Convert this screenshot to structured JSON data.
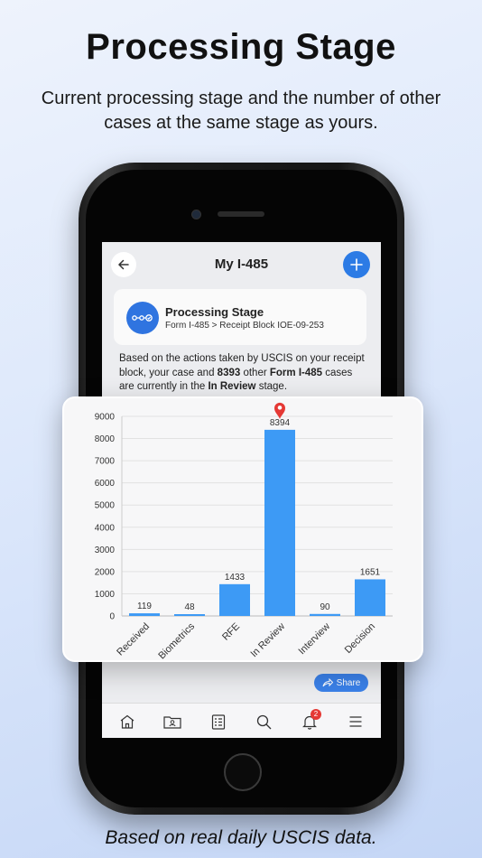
{
  "header": {
    "title": "Processing Stage",
    "subtitle": "Current processing stage and the number of other cases at the same stage as yours."
  },
  "footer": {
    "text": "Based on real daily USCIS data."
  },
  "app": {
    "nav_title": "My I-485",
    "back_icon": "arrow-left-icon",
    "add_icon": "plus-icon",
    "accent_color": "#2c7be5",
    "stage_card": {
      "title": "Processing Stage",
      "subtitle": "Form I-485 > Receipt Block IOE-09-253",
      "icon": "stage-flow-icon"
    },
    "description": {
      "part1": "Based on the actions taken by USCIS on your receipt block, your case and ",
      "count": "8393",
      "part2": " other ",
      "form": "Form I-485",
      "part3": " cases are currently in the ",
      "stage": "In Review",
      "part4": " stage."
    },
    "share_label": "Share",
    "tabbar": {
      "icons": [
        "home-icon",
        "case-folder-icon",
        "document-list-icon",
        "search-icon",
        "notification-bell-icon",
        "menu-icon"
      ],
      "notification_badge": "2"
    }
  },
  "chart_data": {
    "type": "bar",
    "categories": [
      "Received",
      "Biometrics",
      "RFE",
      "In Review",
      "Interview",
      "Decision"
    ],
    "values": [
      119,
      48,
      1433,
      8394,
      90,
      1651
    ],
    "ylim": [
      0,
      9000
    ],
    "yticks": [
      0,
      1000,
      2000,
      3000,
      4000,
      5000,
      6000,
      7000,
      8000,
      9000
    ],
    "highlight_category": "In Review",
    "bar_color": "#3d9af5",
    "marker_color": "#e53935",
    "grid": true,
    "title": "",
    "xlabel": "",
    "ylabel": ""
  }
}
